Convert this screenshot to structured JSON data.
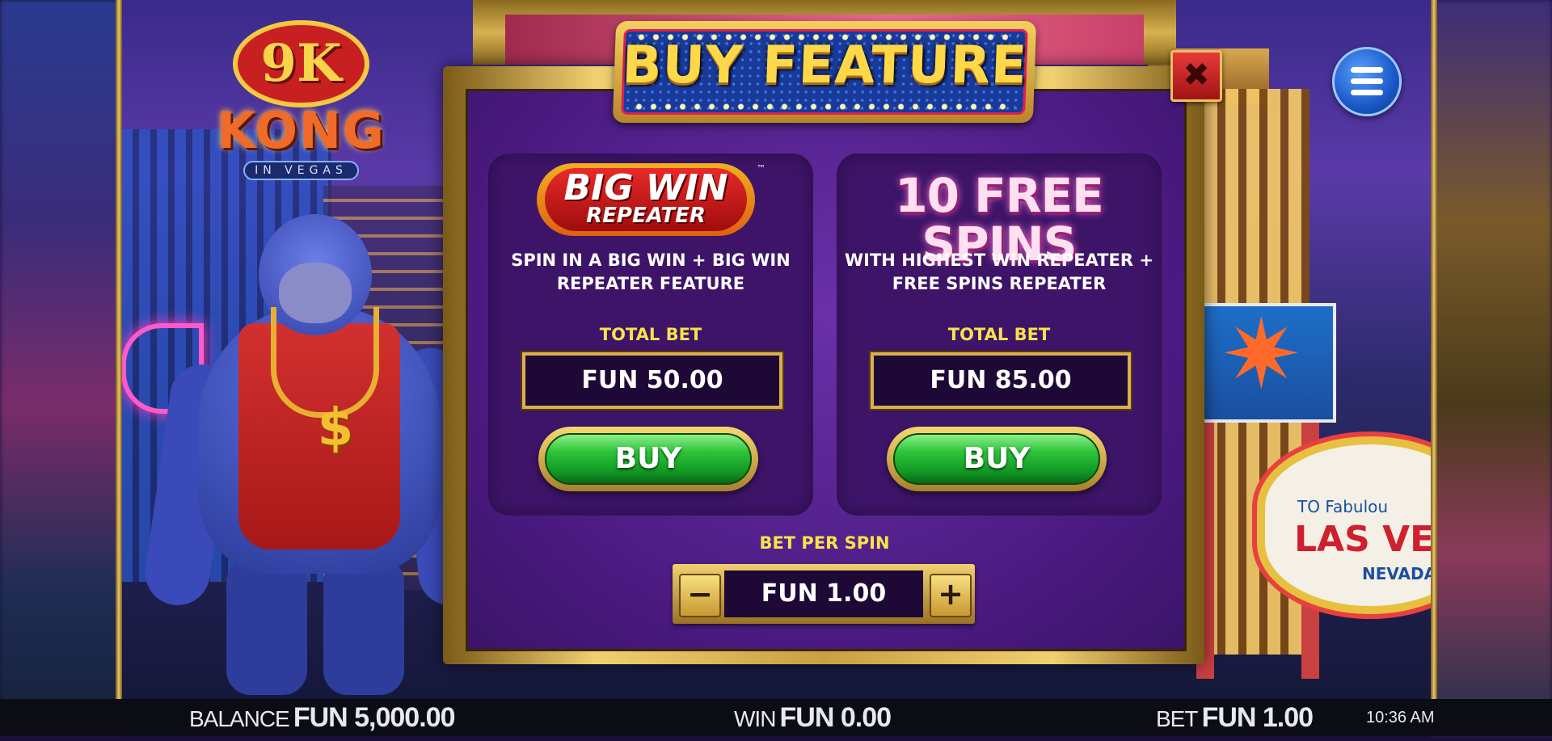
{
  "game": {
    "logo": {
      "line1": "9K",
      "line2": "KONG",
      "line3": "IN VEGAS"
    }
  },
  "modal": {
    "title": "BUY FEATURE",
    "close_symbol": "✖",
    "options": [
      {
        "logo_line1": "BIG WIN",
        "logo_line2": "REPEATER",
        "logo_tm": "™",
        "description": "SPIN IN A BIG WIN + BIG WIN REPEATER FEATURE",
        "total_bet_label": "TOTAL BET",
        "total_bet_value": "FUN 50.00",
        "buy_label": "BUY"
      },
      {
        "title": "10 FREE SPINS",
        "description": "WITH HIGHEST WIN REPEATER + FREE SPINS REPEATER",
        "total_bet_label": "TOTAL BET",
        "total_bet_value": "FUN 85.00",
        "buy_label": "BUY"
      }
    ],
    "bet_per_spin": {
      "label": "BET PER SPIN",
      "value": "FUN 1.00",
      "minus": "−",
      "plus": "+"
    }
  },
  "scene": {
    "vegas_sign": {
      "to": "TO Fabulou",
      "main": "LAS VE",
      "state": "NEVADA"
    }
  },
  "status_bar": {
    "balance_label": "BALANCE",
    "balance_value": "FUN 5,000.00",
    "win_label": "WIN",
    "win_value": "FUN 0.00",
    "bet_label": "BET",
    "bet_value": "FUN 1.00",
    "time": "10:36 AM"
  },
  "icons": {
    "menu": "hamburger-menu-icon",
    "close": "close-x-icon"
  },
  "colors": {
    "buy_green": "#2ec43a",
    "label_yellow": "#f7e34a",
    "panel_purple": "#4a1a80",
    "gold": "#d8b050"
  }
}
